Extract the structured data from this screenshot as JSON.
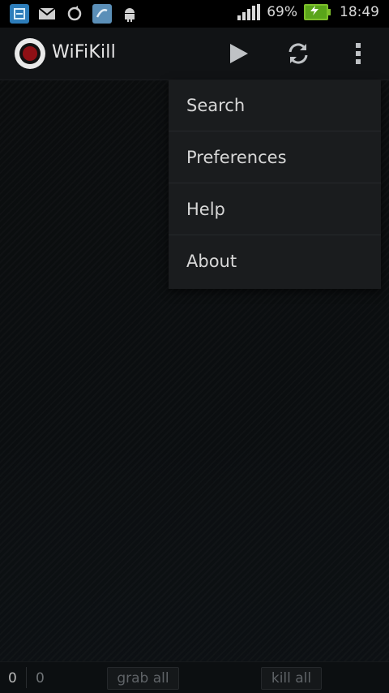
{
  "status_bar": {
    "battery": "69%",
    "time": "18:49",
    "icons": [
      "sim-icon",
      "gmail-icon",
      "sync-icon",
      "gallery-icon",
      "android-icon",
      "signal-icon",
      "battery-charging-icon"
    ]
  },
  "action_bar": {
    "title": "WiFiKill",
    "actions": [
      "play-icon",
      "refresh-icon",
      "overflow-menu-icon"
    ]
  },
  "overflow_menu": {
    "items": [
      {
        "label": "Search"
      },
      {
        "label": "Preferences"
      },
      {
        "label": "Help"
      },
      {
        "label": "About"
      }
    ]
  },
  "bottom_bar": {
    "count_a": "0",
    "count_b": "0",
    "grab_all": "grab all",
    "kill_all": "kill all"
  },
  "colors": {
    "background": "#0b0d0e",
    "menu_bg": "#1a1c1e",
    "logo_red": "#8f1015",
    "battery_green": "#5aa51a"
  }
}
